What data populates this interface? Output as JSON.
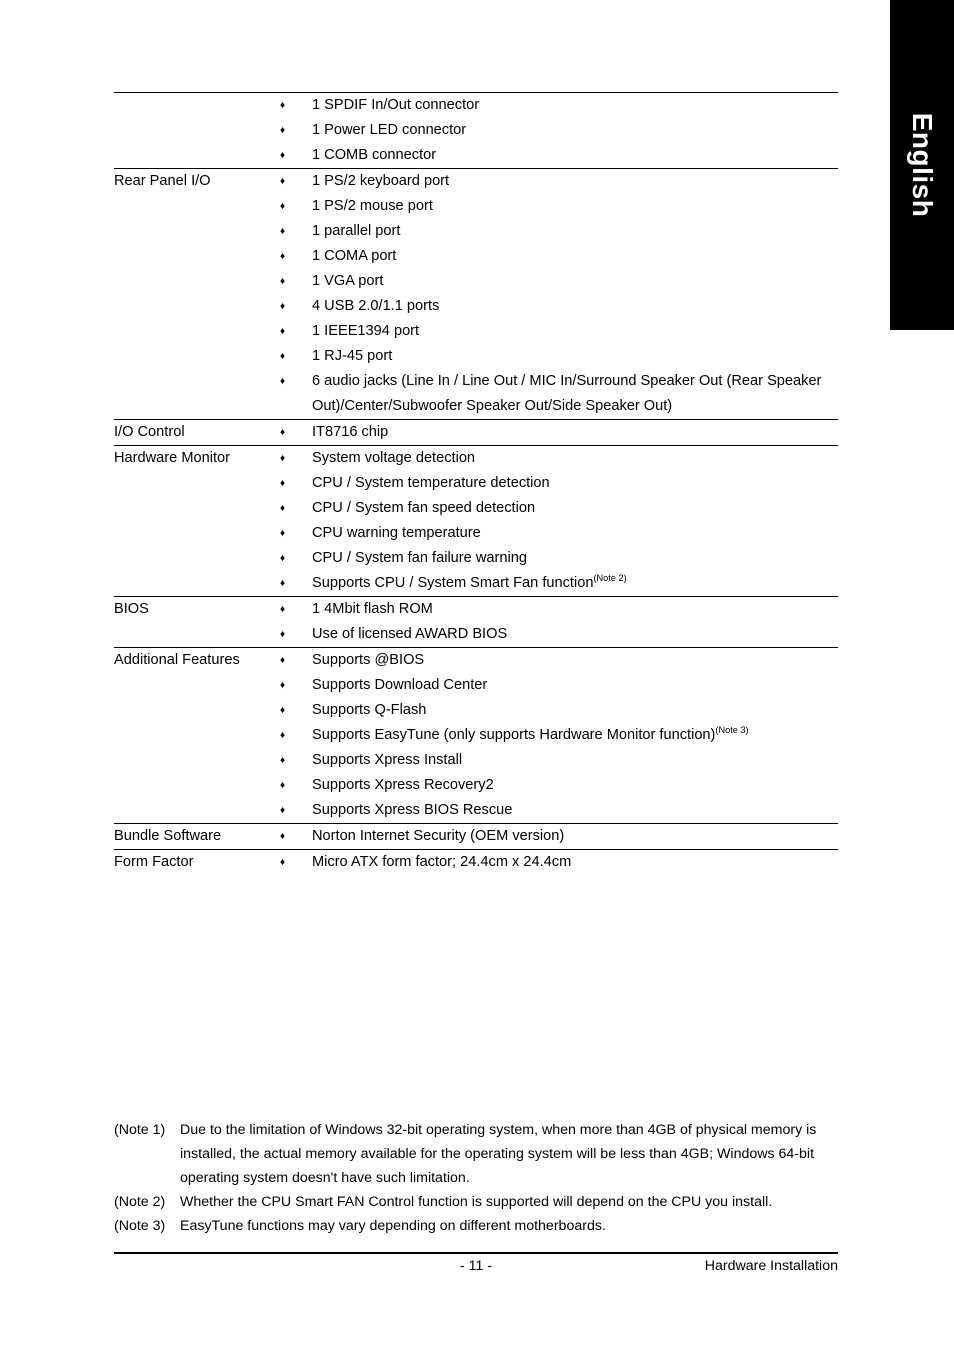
{
  "language_tab": {
    "label": "English"
  },
  "spec_table": {
    "rows": [
      {
        "label": "",
        "has_rule": true,
        "items": [
          {
            "text": "1 SPDIF In/Out connector",
            "note": ""
          },
          {
            "text": "1 Power LED connector",
            "note": ""
          },
          {
            "text": "1 COMB connector",
            "note": ""
          }
        ]
      },
      {
        "label": "Rear Panel I/O",
        "has_rule": true,
        "items": [
          {
            "text": "1 PS/2 keyboard port",
            "note": ""
          },
          {
            "text": "1 PS/2 mouse port",
            "note": ""
          },
          {
            "text": "1 parallel port",
            "note": ""
          },
          {
            "text": "1 COMA port",
            "note": ""
          },
          {
            "text": "1 VGA port",
            "note": ""
          },
          {
            "text": "4 USB 2.0/1.1 ports",
            "note": ""
          },
          {
            "text": "1 IEEE1394 port",
            "note": ""
          },
          {
            "text": "1 RJ-45 port",
            "note": ""
          },
          {
            "text": "6 audio jacks (Line In / Line Out / MIC In/Surround Speaker Out (Rear Speaker Out)/Center/Subwoofer Speaker Out/Side Speaker Out)",
            "note": ""
          }
        ]
      },
      {
        "label": "I/O Control",
        "has_rule": true,
        "items": [
          {
            "text": "IT8716 chip",
            "note": ""
          }
        ]
      },
      {
        "label": "Hardware Monitor",
        "has_rule": true,
        "items": [
          {
            "text": "System voltage detection",
            "note": ""
          },
          {
            "text": "CPU / System temperature detection",
            "note": ""
          },
          {
            "text": "CPU / System fan speed detection",
            "note": ""
          },
          {
            "text": "CPU warning temperature",
            "note": ""
          },
          {
            "text": "CPU / System fan failure warning",
            "note": ""
          },
          {
            "text": "Supports CPU / System Smart Fan function",
            "note": "(Note 2)"
          }
        ]
      },
      {
        "label": "BIOS",
        "has_rule": true,
        "items": [
          {
            "text": "1 4Mbit flash ROM",
            "note": ""
          },
          {
            "text": "Use of licensed AWARD BIOS",
            "note": ""
          }
        ]
      },
      {
        "label": "Additional Features",
        "has_rule": true,
        "items": [
          {
            "text": "Supports @BIOS",
            "note": ""
          },
          {
            "text": "Supports Download Center",
            "note": ""
          },
          {
            "text": "Supports Q-Flash",
            "note": ""
          },
          {
            "text": "Supports EasyTune (only supports Hardware Monitor function)",
            "note": "(Note 3)"
          },
          {
            "text": "Supports Xpress Install",
            "note": ""
          },
          {
            "text": "Supports Xpress Recovery2",
            "note": ""
          },
          {
            "text": "Supports Xpress BIOS Rescue",
            "note": ""
          }
        ]
      },
      {
        "label": "Bundle Software",
        "has_rule": true,
        "items": [
          {
            "text": "Norton Internet Security (OEM version)",
            "note": ""
          }
        ]
      },
      {
        "label": "Form Factor",
        "has_rule": true,
        "items": [
          {
            "text": "Micro ATX form factor; 24.4cm x 24.4cm",
            "note": ""
          }
        ]
      }
    ],
    "bullet_glyph": "♦"
  },
  "footnotes": [
    {
      "tag": "(Note 1)",
      "body": "Due to the limitation of Windows 32-bit operating system, when more than 4GB of physical memory is installed, the actual memory available for the operating system will be less than 4GB; Windows 64-bit operating system doesn't have such limitation."
    },
    {
      "tag": "(Note 2)",
      "body": "Whether the CPU Smart FAN Control function is supported will depend on the CPU you install."
    },
    {
      "tag": "(Note 3)",
      "body": "EasyTune functions may vary depending on different motherboards."
    }
  ],
  "page_footer": {
    "page_number": "- 11 -",
    "section_title": "Hardware Installation"
  }
}
